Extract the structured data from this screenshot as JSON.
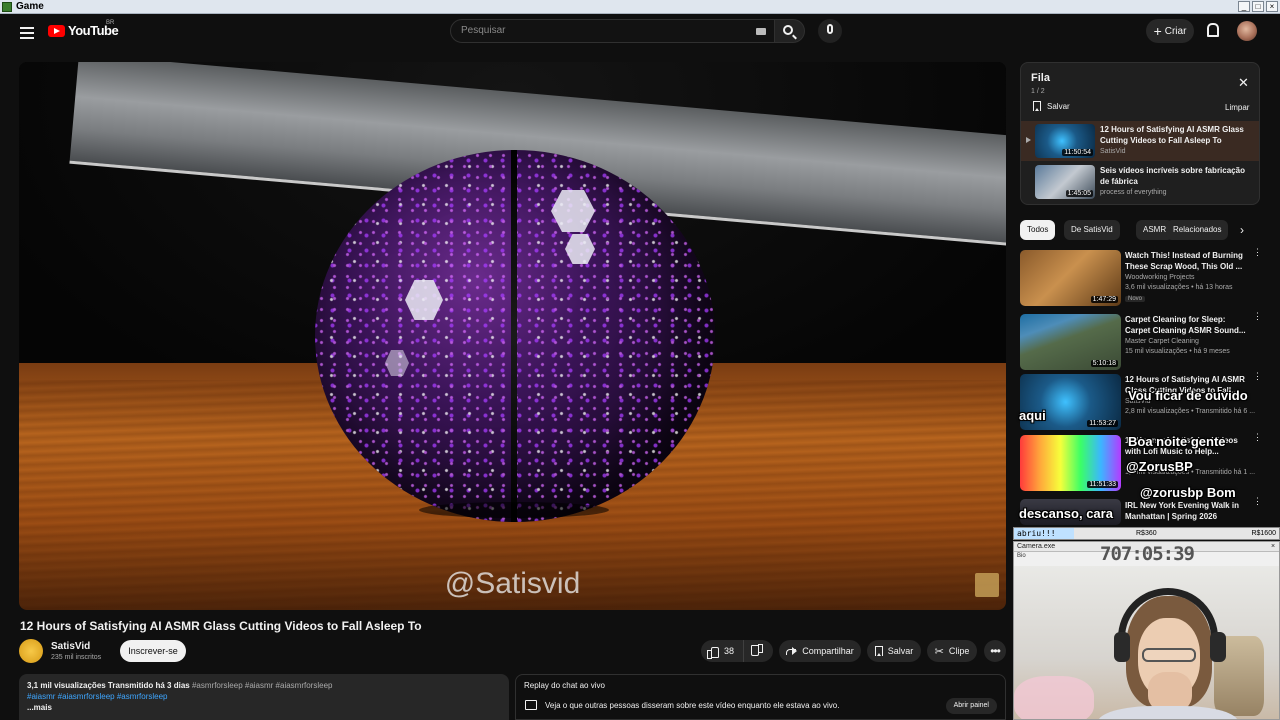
{
  "os": {
    "window_title": "Game"
  },
  "header": {
    "logo_text": "YouTube",
    "logo_region": "BR",
    "search_placeholder": "Pesquisar",
    "create_label": "Criar"
  },
  "player": {
    "watermark": "@Satisvid"
  },
  "video": {
    "title": "12 Hours of Satisfying AI ASMR Glass Cutting Videos to Fall Asleep To",
    "channel": "SatisVid",
    "subscribers": "235 mil inscritos",
    "subscribe_label": "Inscrever-se",
    "likes": "38",
    "share_label": "Compartilhar",
    "save_label": "Salvar",
    "clip_label": "Clipe",
    "description": {
      "stats": "3,1 mil visualizações  Transmitido há 3 dias",
      "tags_line1": "#asmrforsleep #aiasmr #aiasmrforsleep",
      "tags_line2": "#aiasmr #aiasmrforsleep #asmrforsleep",
      "more": "...mais"
    },
    "chat_replay": {
      "title": "Replay do chat ao vivo",
      "subtitle": "Veja o que outras pessoas disseram sobre este vídeo enquanto ele estava ao vivo.",
      "open_label": "Abrir painel"
    }
  },
  "queue": {
    "title": "Fila",
    "count": "1 / 2",
    "save_label": "Salvar",
    "clear_label": "Limpar",
    "items": [
      {
        "title": "12 Hours of Satisfying AI ASMR Glass Cutting Videos to Fall Asleep To",
        "channel": "SatisVid",
        "duration": "11:50:54"
      },
      {
        "title": "Seis vídeos incríveis sobre fabricação de fábrica",
        "channel": "process of everything",
        "duration": "1:45:05"
      }
    ]
  },
  "chips": [
    "Todos",
    "De SatisVid",
    "ASMR",
    "Relacionados"
  ],
  "recommendations": [
    {
      "title": "Watch This! Instead of Burning These Scrap Wood, This Old ...",
      "channel": "Woodworking Projects",
      "meta": "3,6 mil visualizações • há 13 horas",
      "badge": "Novo",
      "duration": "1:47:29"
    },
    {
      "title": "Carpet Cleaning for Sleep: Carpet Cleaning ASMR Sound...",
      "channel": "Master Carpet Cleaning",
      "meta": "15 mil visualizações • há 9 meses",
      "badge": "",
      "duration": "5:10:18"
    },
    {
      "title": "12 Hours of Satisfying AI ASMR Glass Cutting Videos to Fall...",
      "channel": "SatisVid",
      "meta": "2,8 mil visualizações • Transmitido há 6 ...",
      "badge": "",
      "duration": "11:53:27"
    },
    {
      "title": "10 Hours of Satisfying Videos with Lofi Music to Help...",
      "channel": "",
      "meta": "1,4 mil visualizações • Transmitido há 1 ...",
      "badge": "",
      "duration": "11:51:33"
    },
    {
      "title": "IRL New York Evening Walk in Manhattan | Spring 2026",
      "channel": "",
      "meta": "",
      "badge": "",
      "duration": ""
    }
  ],
  "overlays": {
    "line1": "Vou ficar de ouvido",
    "line2": "aqui",
    "line3": "Boa noite gente",
    "line4": "@ZorusBP",
    "line5": "@zorusbp Bom",
    "line6": "descanso, cara"
  },
  "goal": {
    "label": "abriu!!!",
    "current": "R$360",
    "target": "R$1600",
    "fraction": 0.225
  },
  "camera": {
    "window_title": "Camera.exe",
    "timer": "707:05:39",
    "sub": "Bio"
  },
  "colors": {
    "background": "#0f0f0f",
    "brand_red": "#ff0000",
    "link_blue": "#3ea6ff"
  }
}
